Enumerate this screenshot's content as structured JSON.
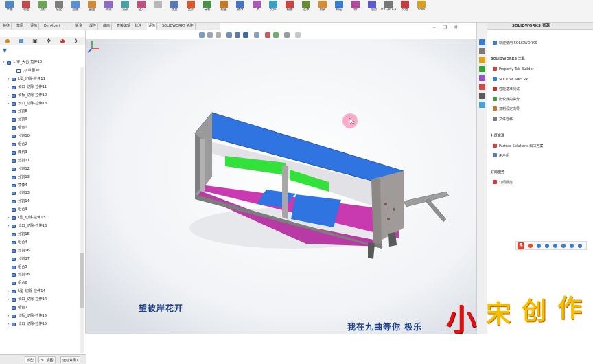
{
  "ribbon": {
    "buttons": [
      {
        "label": "草图",
        "color": "#4f86c6"
      },
      {
        "label": "退出",
        "color": "#c04a4a"
      },
      {
        "label": "切割",
        "color": "#6ea35a"
      },
      {
        "label": "装配",
        "color": "#7d7d7d"
      },
      {
        "label": "绘图",
        "color": "#5b8fd6"
      },
      {
        "label": "剖面",
        "color": "#d08a3c"
      },
      {
        "label": "外观",
        "color": "#8c6bc4"
      },
      {
        "label": "渲染",
        "color": "#4aa0a0"
      },
      {
        "label": "插入",
        "color": "#c05080"
      },
      {
        "label": "",
        "color": "#b8b8b8"
      },
      {
        "label": "建立",
        "color": "#5a79b8"
      },
      {
        "label": "显示",
        "color": "#d7572f"
      },
      {
        "label": "分析",
        "color": "#4a8f4a"
      },
      {
        "label": "检查",
        "color": "#c07a2a"
      },
      {
        "label": "修改",
        "color": "#4673c4"
      },
      {
        "label": "工具",
        "color": "#a75bb5"
      },
      {
        "label": "文件",
        "color": "#3b9ec7"
      },
      {
        "label": "视图",
        "color": "#c94444"
      },
      {
        "label": "选项",
        "color": "#6a8a3a"
      },
      {
        "label": "列表",
        "color": "#d58e34"
      },
      {
        "label": "特征",
        "color": "#3a7ad0"
      },
      {
        "label": "材料",
        "color": "#b04a9a"
      },
      {
        "label": "工程图",
        "color": "#5a5ad0"
      },
      {
        "label": "DXF/PDF/DWG",
        "color": "#777777"
      },
      {
        "label": "文档",
        "color": "#c33d3d"
      },
      {
        "label": "SOW",
        "color": "#d9a020"
      }
    ]
  },
  "tabs": [
    "特征",
    "草图",
    "评估",
    "DimXpert",
    "钣金",
    "焊件",
    "曲面",
    "直接编辑",
    "标注",
    "评估",
    "SOLIDWORKS 插件"
  ],
  "tabs_active_index": 9,
  "feature_tree": {
    "items": [
      {
        "label": "1-零_大台-拉伸10",
        "indent": 0,
        "color": "#5a8ed8",
        "exp": "▾"
      },
      {
        "label": "(-) 草图30",
        "indent": 2,
        "color": "#ffffff",
        "exp": ""
      },
      {
        "label": "L型_切除-拉伸11",
        "indent": 1,
        "color": "#5a8ed8",
        "exp": "▸"
      },
      {
        "label": "长口_切除-拉伸11",
        "indent": 1,
        "color": "#5a8ed8",
        "exp": "▸"
      },
      {
        "label": "长板_切除-拉伸12",
        "indent": 1,
        "color": "#5a8ed8",
        "exp": "▸"
      },
      {
        "label": "长口_切除-拉伸13",
        "indent": 1,
        "color": "#5a8ed8",
        "exp": "▸"
      },
      {
        "label": "分割8",
        "indent": 1,
        "color": "#5a8ed8",
        "exp": ""
      },
      {
        "label": "分割9",
        "indent": 1,
        "color": "#5a8ed8",
        "exp": ""
      },
      {
        "label": "组合1",
        "indent": 1,
        "color": "#5a8ed8",
        "exp": ""
      },
      {
        "label": "分割10",
        "indent": 1,
        "color": "#5a8ed8",
        "exp": ""
      },
      {
        "label": "组合2",
        "indent": 1,
        "color": "#5a8ed8",
        "exp": ""
      },
      {
        "label": "阵列3",
        "indent": 1,
        "color": "#5a8ed8",
        "exp": ""
      },
      {
        "label": "分割11",
        "indent": 1,
        "color": "#5a8ed8",
        "exp": ""
      },
      {
        "label": "分割12",
        "indent": 1,
        "color": "#5a8ed8",
        "exp": ""
      },
      {
        "label": "分割13",
        "indent": 1,
        "color": "#5a8ed8",
        "exp": ""
      },
      {
        "label": "镜像4",
        "indent": 1,
        "color": "#5a8ed8",
        "exp": ""
      },
      {
        "label": "分割13",
        "indent": 1,
        "color": "#5a8ed8",
        "exp": ""
      },
      {
        "label": "分割14",
        "indent": 1,
        "color": "#5a8ed8",
        "exp": ""
      },
      {
        "label": "组合3",
        "indent": 1,
        "color": "#5a8ed8",
        "exp": ""
      },
      {
        "label": "L型_切除-拉伸13",
        "indent": 1,
        "color": "#5a8ed8",
        "exp": "▸"
      },
      {
        "label": "长口_切除-拉伸13",
        "indent": 1,
        "color": "#5a8ed8",
        "exp": "▸"
      },
      {
        "label": "分割15",
        "indent": 1,
        "color": "#5a8ed8",
        "exp": ""
      },
      {
        "label": "组合4",
        "indent": 1,
        "color": "#5a8ed8",
        "exp": ""
      },
      {
        "label": "分割16",
        "indent": 1,
        "color": "#5a8ed8",
        "exp": ""
      },
      {
        "label": "分割17",
        "indent": 1,
        "color": "#5a8ed8",
        "exp": ""
      },
      {
        "label": "组合5",
        "indent": 1,
        "color": "#5a8ed8",
        "exp": ""
      },
      {
        "label": "分割18",
        "indent": 1,
        "color": "#5a8ed8",
        "exp": ""
      },
      {
        "label": "组合6",
        "indent": 1,
        "color": "#5a8ed8",
        "exp": ""
      },
      {
        "label": "L型_切除-拉伸14",
        "indent": 1,
        "color": "#5a8ed8",
        "exp": "▸"
      },
      {
        "label": "长口_切除-拉伸14",
        "indent": 1,
        "color": "#5a8ed8",
        "exp": "▸"
      },
      {
        "label": "组合7",
        "indent": 1,
        "color": "#5a8ed8",
        "exp": ""
      },
      {
        "label": "长板_切除-拉伸15",
        "indent": 1,
        "color": "#5a8ed8",
        "exp": "▸"
      },
      {
        "label": "长口_切除-拉伸15",
        "indent": 1,
        "color": "#5a8ed8",
        "exp": "▸"
      }
    ]
  },
  "bottom_tabs": [
    "模型",
    "3D 视图",
    "运动算例1"
  ],
  "viewport": {
    "subtitle_1": "望彼岸花开",
    "subtitle_2": "我在九曲等你 极乐"
  },
  "task_pane": {
    "title": "SOLIDWORKS 资源",
    "header_item": "欢迎使用 SOLIDWORKS",
    "section_tools": "SOLIDWORKS 工具",
    "tools": [
      {
        "label": "Property Tab Builder",
        "color": "#d04040"
      },
      {
        "label": "SOLIDWORKS Rx",
        "color": "#3a7ad0"
      },
      {
        "label": "性能基准测试",
        "color": "#c03030"
      },
      {
        "label": "比较我的得分",
        "color": "#3a9a3a"
      },
      {
        "label": "复制设定向导",
        "color": "#c07a2a"
      },
      {
        "label": "文件迁移",
        "color": "#7a7a7a"
      }
    ],
    "section_community": "社区资源",
    "community": [
      {
        "label": "Partner Solutions 解决方案",
        "color": "#d04040"
      },
      {
        "label": "用户组",
        "color": "#5a79b8"
      }
    ],
    "section_services": "订阅服务",
    "services": [
      {
        "label": "订阅服务",
        "color": "#d04040"
      }
    ]
  },
  "watermark": {
    "chars": [
      "小",
      "宋",
      "创",
      "作"
    ]
  }
}
